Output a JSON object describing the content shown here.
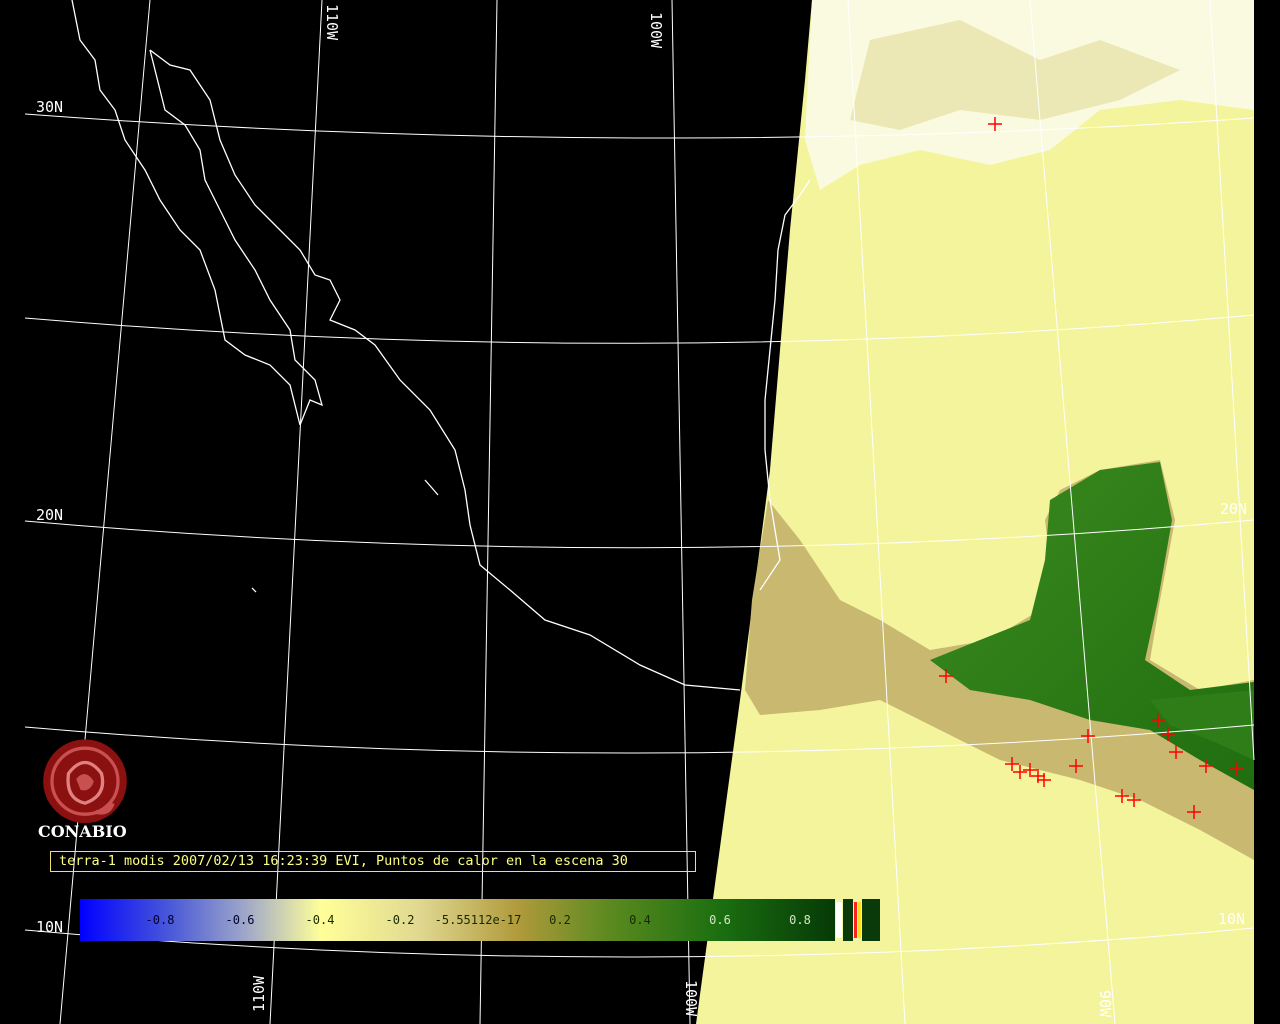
{
  "org": "CONABIO",
  "caption": "terra-1 modis 2007/02/13 16:23:39 EVI, Puntos de calor en la escena 30",
  "grid_labels": {
    "lat_30n": "30N",
    "lat_20n_left": "20N",
    "lat_20n_right": "20N",
    "lat_10n_left": "10N",
    "lat_10n_right": "10N",
    "lon_110w_top": "110W",
    "lon_100w_top": "100W",
    "lon_110w_bottom": "110W",
    "lon_100w_bottom": "100W",
    "lon_90w_bottom": "90W"
  },
  "colorbar": {
    "ticks": [
      "-0.8",
      "-0.6",
      "-0.4",
      "-0.2",
      "-5.55112e-17",
      "0.2",
      "0.4",
      "0.6",
      "0.8"
    ],
    "colors": {
      "low": "#0000ff",
      "mid": "#ffff99",
      "high": "#00460a"
    }
  },
  "colors": {
    "land_coast": "#ffffff",
    "grid": "#ffffff",
    "ocean_data": "#f4f49c",
    "vegetation": "#2a7d18",
    "fire": "#ff0000"
  }
}
